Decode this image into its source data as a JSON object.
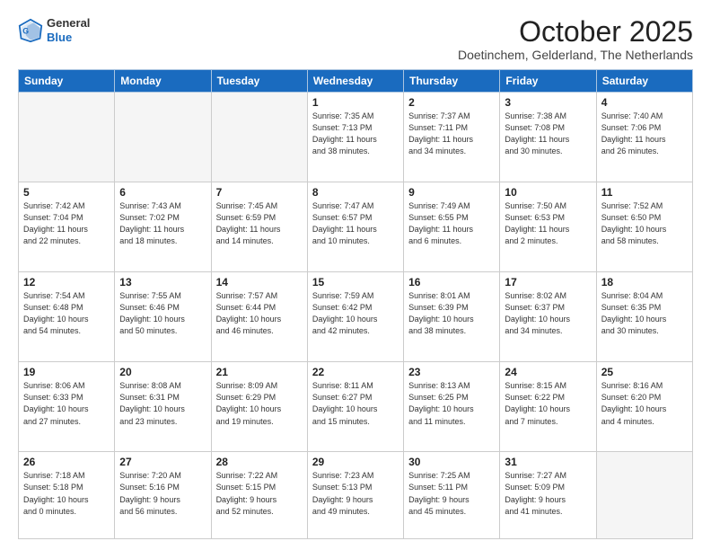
{
  "logo": {
    "line1": "General",
    "line2": "Blue"
  },
  "title": "October 2025",
  "location": "Doetinchem, Gelderland, The Netherlands",
  "headers": [
    "Sunday",
    "Monday",
    "Tuesday",
    "Wednesday",
    "Thursday",
    "Friday",
    "Saturday"
  ],
  "weeks": [
    [
      {
        "day": "",
        "info": "",
        "empty": true
      },
      {
        "day": "",
        "info": "",
        "empty": true
      },
      {
        "day": "",
        "info": "",
        "empty": true
      },
      {
        "day": "1",
        "info": "Sunrise: 7:35 AM\nSunset: 7:13 PM\nDaylight: 11 hours\nand 38 minutes.",
        "empty": false
      },
      {
        "day": "2",
        "info": "Sunrise: 7:37 AM\nSunset: 7:11 PM\nDaylight: 11 hours\nand 34 minutes.",
        "empty": false
      },
      {
        "day": "3",
        "info": "Sunrise: 7:38 AM\nSunset: 7:08 PM\nDaylight: 11 hours\nand 30 minutes.",
        "empty": false
      },
      {
        "day": "4",
        "info": "Sunrise: 7:40 AM\nSunset: 7:06 PM\nDaylight: 11 hours\nand 26 minutes.",
        "empty": false
      }
    ],
    [
      {
        "day": "5",
        "info": "Sunrise: 7:42 AM\nSunset: 7:04 PM\nDaylight: 11 hours\nand 22 minutes.",
        "empty": false
      },
      {
        "day": "6",
        "info": "Sunrise: 7:43 AM\nSunset: 7:02 PM\nDaylight: 11 hours\nand 18 minutes.",
        "empty": false
      },
      {
        "day": "7",
        "info": "Sunrise: 7:45 AM\nSunset: 6:59 PM\nDaylight: 11 hours\nand 14 minutes.",
        "empty": false
      },
      {
        "day": "8",
        "info": "Sunrise: 7:47 AM\nSunset: 6:57 PM\nDaylight: 11 hours\nand 10 minutes.",
        "empty": false
      },
      {
        "day": "9",
        "info": "Sunrise: 7:49 AM\nSunset: 6:55 PM\nDaylight: 11 hours\nand 6 minutes.",
        "empty": false
      },
      {
        "day": "10",
        "info": "Sunrise: 7:50 AM\nSunset: 6:53 PM\nDaylight: 11 hours\nand 2 minutes.",
        "empty": false
      },
      {
        "day": "11",
        "info": "Sunrise: 7:52 AM\nSunset: 6:50 PM\nDaylight: 10 hours\nand 58 minutes.",
        "empty": false
      }
    ],
    [
      {
        "day": "12",
        "info": "Sunrise: 7:54 AM\nSunset: 6:48 PM\nDaylight: 10 hours\nand 54 minutes.",
        "empty": false
      },
      {
        "day": "13",
        "info": "Sunrise: 7:55 AM\nSunset: 6:46 PM\nDaylight: 10 hours\nand 50 minutes.",
        "empty": false
      },
      {
        "day": "14",
        "info": "Sunrise: 7:57 AM\nSunset: 6:44 PM\nDaylight: 10 hours\nand 46 minutes.",
        "empty": false
      },
      {
        "day": "15",
        "info": "Sunrise: 7:59 AM\nSunset: 6:42 PM\nDaylight: 10 hours\nand 42 minutes.",
        "empty": false
      },
      {
        "day": "16",
        "info": "Sunrise: 8:01 AM\nSunset: 6:39 PM\nDaylight: 10 hours\nand 38 minutes.",
        "empty": false
      },
      {
        "day": "17",
        "info": "Sunrise: 8:02 AM\nSunset: 6:37 PM\nDaylight: 10 hours\nand 34 minutes.",
        "empty": false
      },
      {
        "day": "18",
        "info": "Sunrise: 8:04 AM\nSunset: 6:35 PM\nDaylight: 10 hours\nand 30 minutes.",
        "empty": false
      }
    ],
    [
      {
        "day": "19",
        "info": "Sunrise: 8:06 AM\nSunset: 6:33 PM\nDaylight: 10 hours\nand 27 minutes.",
        "empty": false
      },
      {
        "day": "20",
        "info": "Sunrise: 8:08 AM\nSunset: 6:31 PM\nDaylight: 10 hours\nand 23 minutes.",
        "empty": false
      },
      {
        "day": "21",
        "info": "Sunrise: 8:09 AM\nSunset: 6:29 PM\nDaylight: 10 hours\nand 19 minutes.",
        "empty": false
      },
      {
        "day": "22",
        "info": "Sunrise: 8:11 AM\nSunset: 6:27 PM\nDaylight: 10 hours\nand 15 minutes.",
        "empty": false
      },
      {
        "day": "23",
        "info": "Sunrise: 8:13 AM\nSunset: 6:25 PM\nDaylight: 10 hours\nand 11 minutes.",
        "empty": false
      },
      {
        "day": "24",
        "info": "Sunrise: 8:15 AM\nSunset: 6:22 PM\nDaylight: 10 hours\nand 7 minutes.",
        "empty": false
      },
      {
        "day": "25",
        "info": "Sunrise: 8:16 AM\nSunset: 6:20 PM\nDaylight: 10 hours\nand 4 minutes.",
        "empty": false
      }
    ],
    [
      {
        "day": "26",
        "info": "Sunrise: 7:18 AM\nSunset: 5:18 PM\nDaylight: 10 hours\nand 0 minutes.",
        "empty": false
      },
      {
        "day": "27",
        "info": "Sunrise: 7:20 AM\nSunset: 5:16 PM\nDaylight: 9 hours\nand 56 minutes.",
        "empty": false
      },
      {
        "day": "28",
        "info": "Sunrise: 7:22 AM\nSunset: 5:15 PM\nDaylight: 9 hours\nand 52 minutes.",
        "empty": false
      },
      {
        "day": "29",
        "info": "Sunrise: 7:23 AM\nSunset: 5:13 PM\nDaylight: 9 hours\nand 49 minutes.",
        "empty": false
      },
      {
        "day": "30",
        "info": "Sunrise: 7:25 AM\nSunset: 5:11 PM\nDaylight: 9 hours\nand 45 minutes.",
        "empty": false
      },
      {
        "day": "31",
        "info": "Sunrise: 7:27 AM\nSunset: 5:09 PM\nDaylight: 9 hours\nand 41 minutes.",
        "empty": false
      },
      {
        "day": "",
        "info": "",
        "empty": true
      }
    ]
  ]
}
